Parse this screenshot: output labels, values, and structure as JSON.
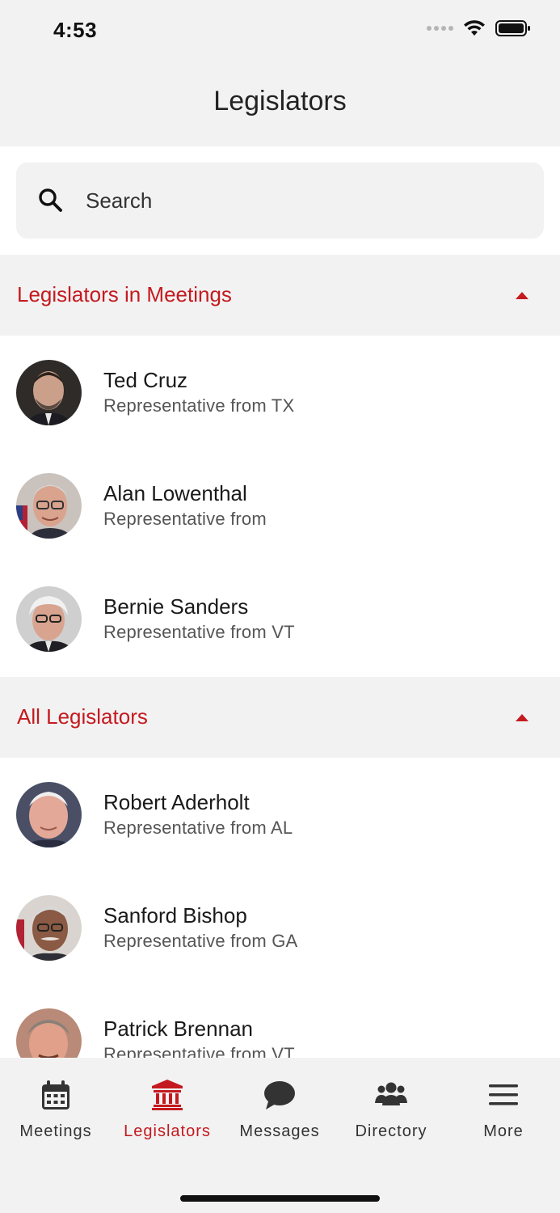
{
  "status": {
    "time": "4:53"
  },
  "nav": {
    "title": "Legislators"
  },
  "search": {
    "placeholder": "Search"
  },
  "sections": [
    {
      "title": "Legislators in Meetings",
      "items": [
        {
          "name": "Ted Cruz",
          "subtitle": "Representative from TX"
        },
        {
          "name": "Alan Lowenthal",
          "subtitle": "Representative from"
        },
        {
          "name": "Bernie Sanders",
          "subtitle": "Representative from VT"
        }
      ]
    },
    {
      "title": "All Legislators",
      "items": [
        {
          "name": "Robert Aderholt",
          "subtitle": "Representative from AL"
        },
        {
          "name": "Sanford Bishop",
          "subtitle": "Representative from GA"
        },
        {
          "name": "Patrick Brennan",
          "subtitle": "Representative from VT"
        }
      ]
    }
  ],
  "tabs": [
    {
      "label": "Meetings",
      "icon": "calendar-icon"
    },
    {
      "label": "Legislators",
      "icon": "capitol-building-icon",
      "active": true
    },
    {
      "label": "Messages",
      "icon": "chat-bubble-icon"
    },
    {
      "label": "Directory",
      "icon": "people-icon"
    },
    {
      "label": "More",
      "icon": "menu-icon"
    }
  ],
  "colors": {
    "accent": "#c41a1f",
    "background": "#f2f2f2",
    "text": "#222222"
  }
}
